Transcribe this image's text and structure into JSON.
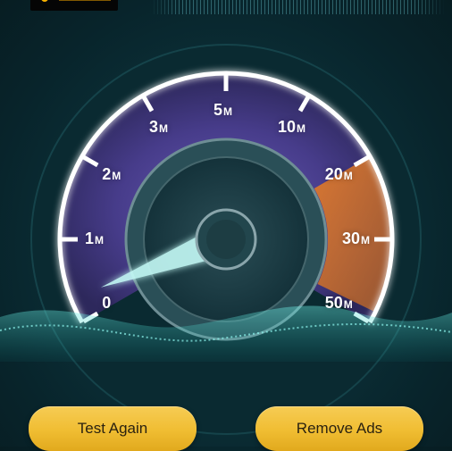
{
  "speedometer": {
    "ticks": [
      {
        "value": "0",
        "unit": ""
      },
      {
        "value": "1",
        "unit": "M"
      },
      {
        "value": "2",
        "unit": "M"
      },
      {
        "value": "3",
        "unit": "M"
      },
      {
        "value": "5",
        "unit": "M"
      },
      {
        "value": "10",
        "unit": "M"
      },
      {
        "value": "20",
        "unit": "M"
      },
      {
        "value": "30",
        "unit": "M"
      },
      {
        "value": "50",
        "unit": "M"
      }
    ],
    "needle_tick_position": 0.3,
    "colors": {
      "arc_fill": "#4a3d8f",
      "arc_edge": "#ffffff",
      "highlight_segment": "#c56a2c",
      "needle": "#bff6f4",
      "button": "#f0bd32",
      "button_text": "#2b2210"
    }
  },
  "buttons": {
    "test_again": "Test Again",
    "remove_ads": "Remove Ads"
  }
}
